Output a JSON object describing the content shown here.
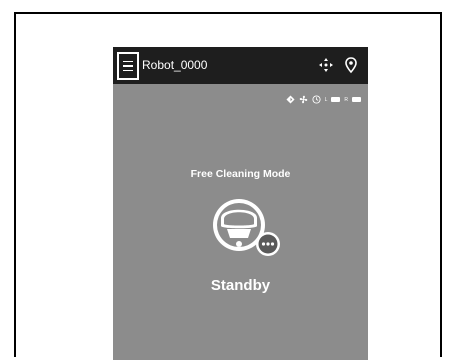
{
  "header": {
    "robot_name": "Robot_0000"
  },
  "icons": {
    "menu": "menu-icon",
    "move": "move-arrows-icon",
    "location": "location-pin-icon",
    "status": [
      "nav-direction-icon",
      "fan-icon",
      "timer-icon",
      "battery-icon"
    ]
  },
  "status": {
    "left_label": "L",
    "right_label": "R"
  },
  "main": {
    "mode_title": "Free Cleaning Mode",
    "state": "Standby"
  },
  "colors": {
    "topbar": "#1e1e1e",
    "screen": "#8c8c8c",
    "foreground": "#ffffff"
  }
}
